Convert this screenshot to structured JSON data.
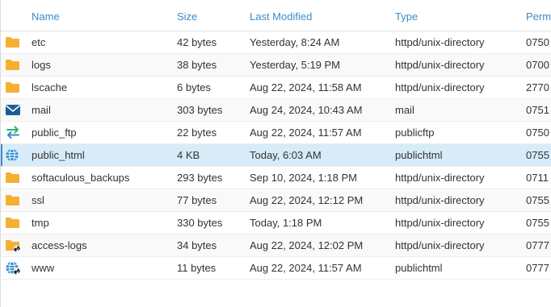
{
  "columns": {
    "name": "Name",
    "size": "Size",
    "modified": "Last Modified",
    "type": "Type",
    "perms": "Perm"
  },
  "colors": {
    "header_text": "#3b8bc9",
    "folder": "#f5b031",
    "mail": "#1c5f96",
    "ftp": "#2bb673",
    "ftp_alt": "#3b8bc9",
    "globe": "#2f8fd1",
    "selected_row": "#d8ebf9"
  },
  "rows": [
    {
      "name": "etc",
      "size": "42 bytes",
      "modified": "Yesterday, 8:24 AM",
      "type": "httpd/unix-directory",
      "perms": "0750",
      "icon": "folder-icon",
      "selected": false
    },
    {
      "name": "logs",
      "size": "38 bytes",
      "modified": "Yesterday, 5:19 PM",
      "type": "httpd/unix-directory",
      "perms": "0700",
      "icon": "folder-icon",
      "selected": false
    },
    {
      "name": "lscache",
      "size": "6 bytes",
      "modified": "Aug 22, 2024, 11:58 AM",
      "type": "httpd/unix-directory",
      "perms": "2770",
      "icon": "folder-icon",
      "selected": false
    },
    {
      "name": "mail",
      "size": "303 bytes",
      "modified": "Aug 24, 2024, 10:43 AM",
      "type": "mail",
      "perms": "0751",
      "icon": "mail-icon",
      "selected": false
    },
    {
      "name": "public_ftp",
      "size": "22 bytes",
      "modified": "Aug 22, 2024, 11:57 AM",
      "type": "publicftp",
      "perms": "0750",
      "icon": "transfer-arrows-icon",
      "selected": false
    },
    {
      "name": "public_html",
      "size": "4 KB",
      "modified": "Today, 6:03 AM",
      "type": "publichtml",
      "perms": "0755",
      "icon": "globe-icon",
      "selected": true
    },
    {
      "name": "softaculous_backups",
      "size": "293 bytes",
      "modified": "Sep 10, 2024, 1:18 PM",
      "type": "httpd/unix-directory",
      "perms": "0711",
      "icon": "folder-icon",
      "selected": false
    },
    {
      "name": "ssl",
      "size": "77 bytes",
      "modified": "Aug 22, 2024, 12:12 PM",
      "type": "httpd/unix-directory",
      "perms": "0755",
      "icon": "folder-icon",
      "selected": false
    },
    {
      "name": "tmp",
      "size": "330 bytes",
      "modified": "Today, 1:18 PM",
      "type": "httpd/unix-directory",
      "perms": "0755",
      "icon": "folder-icon",
      "selected": false
    },
    {
      "name": "access-logs",
      "size": "34 bytes",
      "modified": "Aug 22, 2024, 12:02 PM",
      "type": "httpd/unix-directory",
      "perms": "0777",
      "icon": "folder-link-icon",
      "selected": false
    },
    {
      "name": "www",
      "size": "11 bytes",
      "modified": "Aug 22, 2024, 11:57 AM",
      "type": "publichtml",
      "perms": "0777",
      "icon": "globe-link-icon",
      "selected": false
    }
  ]
}
